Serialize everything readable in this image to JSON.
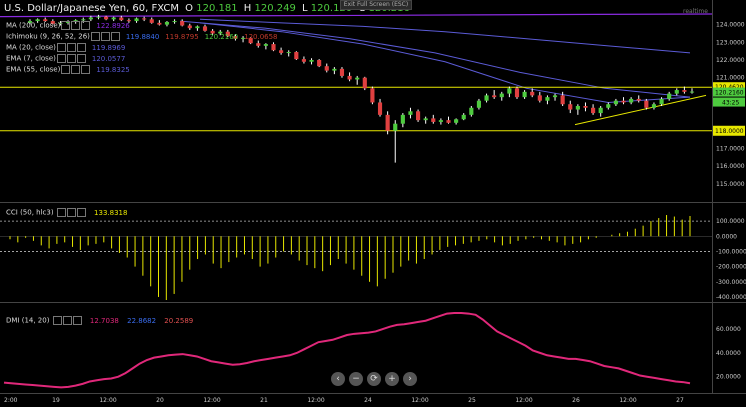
{
  "header": {
    "symbol": "U.S. Dollar/Japanese Yen, 60, FXCM",
    "o_label": "O",
    "o": "120.181",
    "h_label": "H",
    "h": "120.249",
    "l_label": "L",
    "l": "120.120",
    "c_label": "C",
    "c": "120.216"
  },
  "exit_fullscreen": "Exit Full Screen (ESC)",
  "realtime_label": "realtime",
  "indicators": [
    {
      "name": "MA (200, close)",
      "values": [
        "122.8926"
      ],
      "colors": [
        "#8a2be2"
      ]
    },
    {
      "name": "Ichimoku (9, 26, 52, 26)",
      "values": [
        "119.8840",
        "119.8795",
        "120.2160",
        "120.0658"
      ],
      "colors": [
        "#3a6df0",
        "#c0392b",
        "#4ecb3f",
        "#c0392b"
      ]
    },
    {
      "name": "MA (20, close)",
      "values": [
        "119.8969"
      ],
      "colors": [
        "#5b5bd6"
      ]
    },
    {
      "name": "EMA (7, close)",
      "values": [
        "120.0577"
      ],
      "colors": [
        "#5b5bd6"
      ]
    },
    {
      "name": "EMA (55, close)",
      "values": [
        "119.8325"
      ],
      "colors": [
        "#5b5bd6"
      ]
    }
  ],
  "cci": {
    "name": "CCI (50, hlc3)",
    "value": "133.8318"
  },
  "dmi": {
    "name": "DMI (14, 20)",
    "values": [
      "12.7038",
      "22.8682",
      "20.2589"
    ],
    "colors": [
      "#e0287a",
      "#3a6df0",
      "#e05050"
    ]
  },
  "colors": {
    "up": "#4ecb3f",
    "down": "#e04040",
    "wick": "#ffffff",
    "hline": "#e8e800",
    "ma200": "#8a2be2",
    "ma": "#5b5bd6",
    "cci": "#e8e800",
    "adx": "#e0287a"
  },
  "nav_buttons": [
    "‹",
    "−",
    "⟳",
    "+",
    "›"
  ],
  "chart_data": [
    {
      "type": "candlestick",
      "title": "U.S. Dollar/Japanese Yen, 60, FXCM",
      "ylim": [
        114.2,
        124.6
      ],
      "y_ticks": [
        "124.0000",
        "123.0000",
        "122.0000",
        "121.0000",
        "117.0000",
        "116.0000",
        "115.0000"
      ],
      "x_ticks": [
        "2:00",
        "19",
        "12:00",
        "20",
        "12:00",
        "21",
        "12:00",
        "24",
        "12:00",
        "25",
        "12:00",
        "26",
        "12:00",
        "27"
      ],
      "last_price": "120.2160",
      "ask_price": "120.2160",
      "countdown": "43:25",
      "horizontal_lines": [
        {
          "value": 120.462,
          "label": "120.4620"
        },
        {
          "value": 118.0,
          "label": "118.0000"
        }
      ],
      "candles": [
        [
          124.1,
          124.3,
          124.0,
          124.2
        ],
        [
          124.2,
          124.35,
          124.1,
          124.3
        ],
        [
          124.3,
          124.4,
          124.15,
          124.2
        ],
        [
          124.2,
          124.3,
          124.0,
          124.05
        ],
        [
          124.05,
          124.2,
          123.95,
          124.1
        ],
        [
          124.1,
          124.25,
          124.0,
          124.15
        ],
        [
          124.15,
          124.3,
          124.05,
          124.25
        ],
        [
          124.25,
          124.4,
          124.1,
          124.3
        ],
        [
          124.3,
          124.5,
          124.2,
          124.4
        ],
        [
          124.4,
          124.55,
          124.3,
          124.45
        ],
        [
          124.45,
          124.5,
          124.25,
          124.3
        ],
        [
          124.3,
          124.45,
          124.2,
          124.4
        ],
        [
          124.4,
          124.5,
          124.2,
          124.25
        ],
        [
          124.25,
          124.35,
          124.1,
          124.2
        ],
        [
          124.2,
          124.4,
          124.1,
          124.35
        ],
        [
          124.35,
          124.45,
          124.2,
          124.3
        ],
        [
          124.3,
          124.4,
          124.05,
          124.1
        ],
        [
          124.1,
          124.25,
          123.95,
          124.0
        ],
        [
          124.0,
          124.2,
          123.9,
          124.15
        ],
        [
          124.15,
          124.3,
          124.05,
          124.2
        ],
        [
          124.2,
          124.3,
          123.9,
          123.95
        ],
        [
          123.95,
          124.05,
          123.7,
          123.8
        ],
        [
          123.8,
          123.95,
          123.65,
          123.9
        ],
        [
          123.9,
          124.0,
          123.6,
          123.65
        ],
        [
          123.65,
          123.75,
          123.4,
          123.5
        ],
        [
          123.5,
          123.7,
          123.4,
          123.6
        ],
        [
          123.6,
          123.7,
          123.3,
          123.35
        ],
        [
          123.35,
          123.45,
          123.1,
          123.2
        ],
        [
          123.2,
          123.35,
          123.0,
          123.25
        ],
        [
          123.25,
          123.3,
          122.9,
          122.95
        ],
        [
          122.95,
          123.1,
          122.7,
          122.8
        ],
        [
          122.8,
          122.95,
          122.6,
          122.9
        ],
        [
          122.9,
          123.0,
          122.5,
          122.55
        ],
        [
          122.55,
          122.7,
          122.3,
          122.4
        ],
        [
          122.4,
          122.55,
          122.2,
          122.45
        ],
        [
          122.45,
          122.5,
          122.0,
          122.05
        ],
        [
          122.05,
          122.2,
          121.8,
          121.9
        ],
        [
          121.9,
          122.1,
          121.75,
          122.0
        ],
        [
          122.0,
          122.05,
          121.6,
          121.65
        ],
        [
          121.65,
          121.8,
          121.3,
          121.4
        ],
        [
          121.4,
          121.6,
          121.2,
          121.5
        ],
        [
          121.5,
          121.6,
          121.0,
          121.1
        ],
        [
          121.1,
          121.3,
          120.8,
          120.9
        ],
        [
          120.9,
          121.1,
          120.6,
          121.0
        ],
        [
          121.0,
          121.05,
          120.3,
          120.4
        ],
        [
          120.4,
          120.5,
          119.5,
          119.6
        ],
        [
          119.6,
          119.8,
          118.8,
          118.9
        ],
        [
          118.9,
          119.1,
          117.8,
          118.0
        ],
        [
          118.0,
          118.6,
          116.2,
          118.4
        ],
        [
          118.4,
          119.0,
          118.2,
          118.9
        ],
        [
          118.9,
          119.3,
          118.7,
          119.1
        ],
        [
          119.1,
          119.2,
          118.5,
          118.6
        ],
        [
          118.6,
          118.8,
          118.4,
          118.7
        ],
        [
          118.7,
          118.9,
          118.4,
          118.5
        ],
        [
          118.5,
          118.7,
          118.35,
          118.6
        ],
        [
          118.6,
          118.8,
          118.4,
          118.45
        ],
        [
          118.45,
          118.7,
          118.35,
          118.65
        ],
        [
          118.65,
          119.0,
          118.6,
          118.9
        ],
        [
          118.9,
          119.4,
          118.8,
          119.3
        ],
        [
          119.3,
          119.8,
          119.2,
          119.7
        ],
        [
          119.7,
          120.1,
          119.6,
          120.0
        ],
        [
          120.0,
          120.3,
          119.8,
          119.9
        ],
        [
          119.9,
          120.2,
          119.7,
          120.1
        ],
        [
          120.1,
          120.5,
          119.9,
          120.4
        ],
        [
          120.4,
          120.5,
          119.8,
          119.9
        ],
        [
          119.9,
          120.3,
          119.8,
          120.2
        ],
        [
          120.2,
          120.4,
          119.9,
          120.0
        ],
        [
          120.0,
          120.2,
          119.6,
          119.7
        ],
        [
          119.7,
          120.0,
          119.5,
          119.9
        ],
        [
          119.9,
          120.1,
          119.7,
          120.0
        ],
        [
          120.0,
          120.2,
          119.4,
          119.5
        ],
        [
          119.5,
          119.7,
          119.0,
          119.2
        ],
        [
          119.2,
          119.5,
          118.9,
          119.4
        ],
        [
          119.4,
          119.6,
          119.1,
          119.3
        ],
        [
          119.3,
          119.5,
          118.9,
          119.0
        ],
        [
          119.0,
          119.4,
          118.8,
          119.3
        ],
        [
          119.3,
          119.6,
          119.2,
          119.5
        ],
        [
          119.5,
          119.8,
          119.4,
          119.7
        ],
        [
          119.7,
          119.9,
          119.5,
          119.6
        ],
        [
          119.6,
          119.9,
          119.5,
          119.8
        ],
        [
          119.8,
          120.0,
          119.6,
          119.7
        ],
        [
          119.7,
          119.8,
          119.2,
          119.3
        ],
        [
          119.3,
          119.6,
          119.2,
          119.5
        ],
        [
          119.5,
          119.9,
          119.4,
          119.8
        ],
        [
          119.8,
          120.2,
          119.7,
          120.1
        ],
        [
          120.1,
          120.4,
          120.0,
          120.3
        ],
        [
          120.3,
          120.5,
          120.1,
          120.2
        ],
        [
          120.2,
          120.4,
          120.1,
          120.216
        ]
      ],
      "ma200": [
        124.45,
        124.48,
        124.5,
        124.52,
        124.55,
        124.58,
        124.6
      ],
      "ma_blue_1": [
        124.3,
        124.1,
        123.9,
        123.6,
        123.2,
        122.8,
        122.4
      ],
      "ma_blue_2": [
        124.2,
        123.8,
        123.2,
        122.4,
        121.3,
        120.4,
        119.9
      ],
      "ma_blue_3": [
        124.1,
        123.6,
        122.9,
        121.9,
        120.4,
        119.6,
        119.9
      ],
      "trend_line": [
        [
          118.35,
          119.2
        ],
        [
          119.0,
          120.0
        ]
      ]
    },
    {
      "type": "bar",
      "title": "CCI (50, hlc3)",
      "ylim": [
        -420,
        160
      ],
      "y_ticks": [
        "100.0000",
        "0.0000",
        "-100.0000",
        "-200.0000",
        "-300.0000",
        "-400.0000"
      ],
      "bands": [
        100,
        -100
      ],
      "values": [
        -20,
        -40,
        -10,
        -30,
        -60,
        -80,
        -50,
        -40,
        -70,
        -90,
        -60,
        -50,
        -40,
        -80,
        -110,
        -140,
        -200,
        -260,
        -330,
        -400,
        -420,
        -380,
        -300,
        -220,
        -150,
        -120,
        -180,
        -210,
        -170,
        -140,
        -120,
        -150,
        -200,
        -180,
        -140,
        -100,
        -120,
        -160,
        -190,
        -210,
        -230,
        -190,
        -150,
        -180,
        -220,
        -260,
        -300,
        -330,
        -280,
        -240,
        -200,
        -160,
        -180,
        -150,
        -120,
        -90,
        -70,
        -60,
        -50,
        -40,
        -30,
        -20,
        -40,
        -60,
        -50,
        -30,
        -20,
        -10,
        -20,
        -30,
        -40,
        -60,
        -50,
        -40,
        -20,
        -10,
        0,
        10,
        20,
        30,
        50,
        70,
        100,
        120,
        140,
        130,
        110,
        133.8
      ]
    },
    {
      "type": "line",
      "title": "DMI (14, 20)",
      "ylim": [
        8,
        76
      ],
      "y_ticks": [
        "60.0000",
        "40.0000",
        "20.0000"
      ],
      "values": [
        15,
        14.5,
        14,
        13.5,
        13,
        12.5,
        12,
        11.5,
        11,
        11.5,
        12.5,
        14,
        16,
        17,
        18,
        18.5,
        20,
        23,
        27,
        31,
        34,
        36,
        37,
        38,
        38.5,
        39,
        38,
        37,
        35,
        33,
        32,
        31,
        30,
        30.5,
        31.5,
        33,
        34,
        35,
        36,
        37,
        38,
        40,
        43,
        46,
        49,
        50,
        51,
        53,
        55,
        56,
        56.5,
        57,
        58,
        60,
        62,
        63.5,
        64,
        65,
        66,
        67,
        69,
        71,
        73,
        73.5,
        73.5,
        73,
        72,
        68,
        63,
        58,
        55,
        52,
        49,
        46,
        42,
        40,
        38,
        37,
        36,
        35,
        35,
        34,
        33,
        31,
        29,
        28,
        27,
        25,
        23,
        21,
        20,
        19,
        18,
        17,
        16,
        15.5,
        14.5
      ]
    }
  ]
}
